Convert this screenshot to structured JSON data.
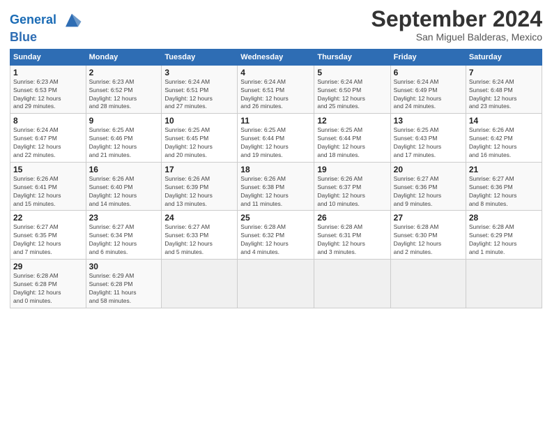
{
  "logo": {
    "line1": "General",
    "line2": "Blue"
  },
  "header": {
    "month": "September 2024",
    "location": "San Miguel Balderas, Mexico"
  },
  "weekdays": [
    "Sunday",
    "Monday",
    "Tuesday",
    "Wednesday",
    "Thursday",
    "Friday",
    "Saturday"
  ],
  "weeks": [
    [
      {
        "day": "1",
        "info": "Sunrise: 6:23 AM\nSunset: 6:53 PM\nDaylight: 12 hours\nand 29 minutes."
      },
      {
        "day": "2",
        "info": "Sunrise: 6:23 AM\nSunset: 6:52 PM\nDaylight: 12 hours\nand 28 minutes."
      },
      {
        "day": "3",
        "info": "Sunrise: 6:24 AM\nSunset: 6:51 PM\nDaylight: 12 hours\nand 27 minutes."
      },
      {
        "day": "4",
        "info": "Sunrise: 6:24 AM\nSunset: 6:51 PM\nDaylight: 12 hours\nand 26 minutes."
      },
      {
        "day": "5",
        "info": "Sunrise: 6:24 AM\nSunset: 6:50 PM\nDaylight: 12 hours\nand 25 minutes."
      },
      {
        "day": "6",
        "info": "Sunrise: 6:24 AM\nSunset: 6:49 PM\nDaylight: 12 hours\nand 24 minutes."
      },
      {
        "day": "7",
        "info": "Sunrise: 6:24 AM\nSunset: 6:48 PM\nDaylight: 12 hours\nand 23 minutes."
      }
    ],
    [
      {
        "day": "8",
        "info": "Sunrise: 6:24 AM\nSunset: 6:47 PM\nDaylight: 12 hours\nand 22 minutes."
      },
      {
        "day": "9",
        "info": "Sunrise: 6:25 AM\nSunset: 6:46 PM\nDaylight: 12 hours\nand 21 minutes."
      },
      {
        "day": "10",
        "info": "Sunrise: 6:25 AM\nSunset: 6:45 PM\nDaylight: 12 hours\nand 20 minutes."
      },
      {
        "day": "11",
        "info": "Sunrise: 6:25 AM\nSunset: 6:44 PM\nDaylight: 12 hours\nand 19 minutes."
      },
      {
        "day": "12",
        "info": "Sunrise: 6:25 AM\nSunset: 6:44 PM\nDaylight: 12 hours\nand 18 minutes."
      },
      {
        "day": "13",
        "info": "Sunrise: 6:25 AM\nSunset: 6:43 PM\nDaylight: 12 hours\nand 17 minutes."
      },
      {
        "day": "14",
        "info": "Sunrise: 6:26 AM\nSunset: 6:42 PM\nDaylight: 12 hours\nand 16 minutes."
      }
    ],
    [
      {
        "day": "15",
        "info": "Sunrise: 6:26 AM\nSunset: 6:41 PM\nDaylight: 12 hours\nand 15 minutes."
      },
      {
        "day": "16",
        "info": "Sunrise: 6:26 AM\nSunset: 6:40 PM\nDaylight: 12 hours\nand 14 minutes."
      },
      {
        "day": "17",
        "info": "Sunrise: 6:26 AM\nSunset: 6:39 PM\nDaylight: 12 hours\nand 13 minutes."
      },
      {
        "day": "18",
        "info": "Sunrise: 6:26 AM\nSunset: 6:38 PM\nDaylight: 12 hours\nand 11 minutes."
      },
      {
        "day": "19",
        "info": "Sunrise: 6:26 AM\nSunset: 6:37 PM\nDaylight: 12 hours\nand 10 minutes."
      },
      {
        "day": "20",
        "info": "Sunrise: 6:27 AM\nSunset: 6:36 PM\nDaylight: 12 hours\nand 9 minutes."
      },
      {
        "day": "21",
        "info": "Sunrise: 6:27 AM\nSunset: 6:36 PM\nDaylight: 12 hours\nand 8 minutes."
      }
    ],
    [
      {
        "day": "22",
        "info": "Sunrise: 6:27 AM\nSunset: 6:35 PM\nDaylight: 12 hours\nand 7 minutes."
      },
      {
        "day": "23",
        "info": "Sunrise: 6:27 AM\nSunset: 6:34 PM\nDaylight: 12 hours\nand 6 minutes."
      },
      {
        "day": "24",
        "info": "Sunrise: 6:27 AM\nSunset: 6:33 PM\nDaylight: 12 hours\nand 5 minutes."
      },
      {
        "day": "25",
        "info": "Sunrise: 6:28 AM\nSunset: 6:32 PM\nDaylight: 12 hours\nand 4 minutes."
      },
      {
        "day": "26",
        "info": "Sunrise: 6:28 AM\nSunset: 6:31 PM\nDaylight: 12 hours\nand 3 minutes."
      },
      {
        "day": "27",
        "info": "Sunrise: 6:28 AM\nSunset: 6:30 PM\nDaylight: 12 hours\nand 2 minutes."
      },
      {
        "day": "28",
        "info": "Sunrise: 6:28 AM\nSunset: 6:29 PM\nDaylight: 12 hours\nand 1 minute."
      }
    ],
    [
      {
        "day": "29",
        "info": "Sunrise: 6:28 AM\nSunset: 6:28 PM\nDaylight: 12 hours\nand 0 minutes."
      },
      {
        "day": "30",
        "info": "Sunrise: 6:29 AM\nSunset: 6:28 PM\nDaylight: 11 hours\nand 58 minutes."
      },
      {
        "day": "",
        "info": ""
      },
      {
        "day": "",
        "info": ""
      },
      {
        "day": "",
        "info": ""
      },
      {
        "day": "",
        "info": ""
      },
      {
        "day": "",
        "info": ""
      }
    ]
  ]
}
